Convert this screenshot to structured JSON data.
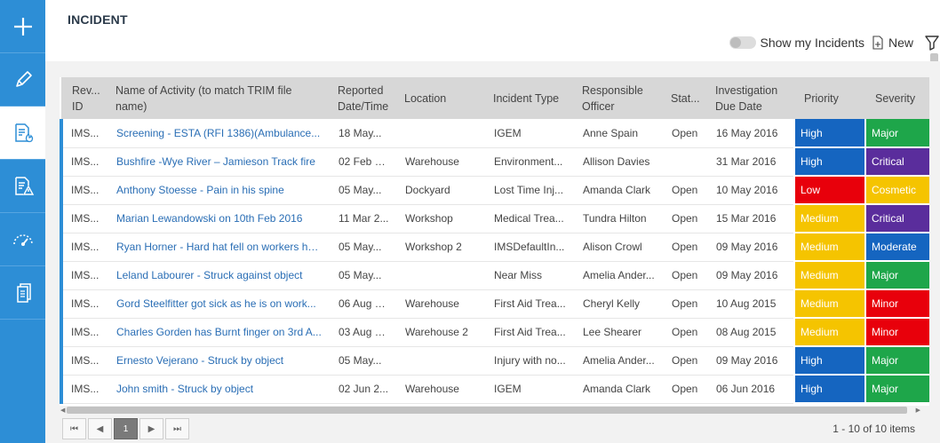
{
  "page": {
    "title": "INCIDENT"
  },
  "toolbar": {
    "show_my_incidents": "Show my Incidents",
    "new_label": "New"
  },
  "sidebar": {
    "items": [
      {
        "icon": "plus-icon"
      },
      {
        "icon": "pencil-icon"
      },
      {
        "icon": "incident-report-icon"
      },
      {
        "icon": "hazard-report-icon"
      },
      {
        "icon": "gauge-icon"
      },
      {
        "icon": "documents-icon"
      }
    ]
  },
  "table": {
    "columns": [
      "Rev... ID",
      "Name of Activity (to match TRIM file name)",
      "Reported Date/Time",
      "Location",
      "Incident Type",
      "Responsible Officer",
      "Stat...",
      "Investigation Due Date",
      "Priority",
      "Severity"
    ],
    "rows": [
      [
        "IMS...",
        "Screening - ESTA (RFI 1386)(Ambulance...",
        "18 May...",
        "",
        "IGEM",
        "Anne Spain",
        "Open",
        "16 May 2016",
        "High",
        "Major"
      ],
      [
        "IMS...",
        "Bushfire -Wye River – Jamieson Track fire",
        "02 Feb 2...",
        "Warehouse",
        "Environment...",
        "Allison Davies",
        "",
        "31 Mar 2016",
        "High",
        "Critical"
      ],
      [
        "IMS...",
        "Anthony Stoesse - Pain in his spine",
        "05 May...",
        "Dockyard",
        "Lost Time Inj...",
        "Amanda Clark",
        "Open",
        "10 May 2016",
        "Low",
        "Cosmetic"
      ],
      [
        "IMS...",
        "Marian Lewandowski on 10th Feb 2016",
        "11 Mar 2...",
        "Workshop",
        "Medical Trea...",
        "Tundra Hilton",
        "Open",
        "15 Mar 2016",
        "Medium",
        "Critical"
      ],
      [
        "IMS...",
        "Ryan Horner - Hard hat fell on workers he...",
        "05 May...",
        "Workshop 2",
        "IMSDefaultIn...",
        "Alison Crowl",
        "Open",
        "09 May 2016",
        "Medium",
        "Moderate"
      ],
      [
        "IMS...",
        "Leland Labourer - Struck against object",
        "05 May...",
        "",
        "Near Miss",
        "Amelia Ander...",
        "Open",
        "09 May 2016",
        "Medium",
        "Major"
      ],
      [
        "IMS...",
        "Gord Steelfitter got sick as he is on work...",
        "06 Aug 2...",
        "Warehouse",
        "First Aid Trea...",
        "Cheryl Kelly",
        "Open",
        "10 Aug 2015",
        "Medium",
        "Minor"
      ],
      [
        "IMS...",
        "Charles Gorden has Burnt finger on 3rd A...",
        "03 Aug 2...",
        "Warehouse 2",
        "First Aid Trea...",
        "Lee Shearer",
        "Open",
        "08 Aug 2015",
        "Medium",
        "Minor"
      ],
      [
        "IMS...",
        "Ernesto Vejerano - Struck by object",
        "05 May...",
        "",
        "Injury with no...",
        "Amelia Ander...",
        "Open",
        "09 May 2016",
        "High",
        "Major"
      ],
      [
        "IMS...",
        "John smith - Struck by object",
        "02 Jun 2...",
        "Warehouse",
        "IGEM",
        "Amanda Clark",
        "Open",
        "06 Jun 2016",
        "High",
        "Major"
      ]
    ]
  },
  "colors": {
    "priority": {
      "High": "#1565c0",
      "Low": "#e8000b",
      "Medium": "#f5c400"
    },
    "severity": {
      "Major": "#1ea64a",
      "Critical": "#5a2d9c",
      "Cosmetic": "#f5c400",
      "Moderate": "#1565c0",
      "Minor": "#e8000b"
    },
    "accent": "#2d8ed6"
  },
  "pager": {
    "current_page": "1",
    "count_text": "1 - 10 of 10 items"
  }
}
